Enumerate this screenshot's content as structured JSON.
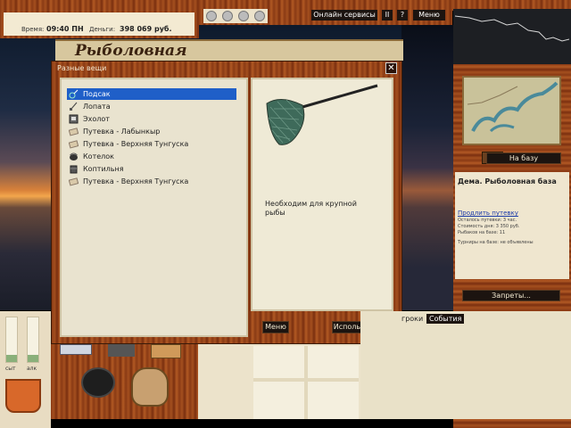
{
  "top": {
    "time_label": "Время:",
    "time_value": "09:40 ПН",
    "money_label": "Деньги:",
    "money_value": "398 069 руб.",
    "online_services": "Онлайн сервисы",
    "pause": "II",
    "help": "?",
    "menu": "Меню"
  },
  "banner": {
    "title": "Рыболовная"
  },
  "dialog": {
    "title": "Разные вещи",
    "close": "✕",
    "items": [
      {
        "label": "Подсак",
        "icon": "landing-net-icon",
        "selected": true
      },
      {
        "label": "Лопата",
        "icon": "shovel-icon",
        "selected": false
      },
      {
        "label": "Эхолот",
        "icon": "echo-sounder-icon",
        "selected": false
      },
      {
        "label": "Путевка - Лабынкыр",
        "icon": "voucher-icon",
        "selected": false
      },
      {
        "label": "Путевка - Верхняя Тунгуска",
        "icon": "voucher-icon",
        "selected": false
      },
      {
        "label": "Котелок",
        "icon": "pot-icon",
        "selected": false
      },
      {
        "label": "Коптильня",
        "icon": "smoker-icon",
        "selected": false
      },
      {
        "label": "Путевка - Верхняя Тунгуска",
        "icon": "voucher-icon",
        "selected": false
      }
    ],
    "description": "Необходим для крупной рыбы",
    "menu_button": "Меню",
    "use_button": "Использовать"
  },
  "right": {
    "to_base": "На базу",
    "base_title": "Дема. Рыболовная база",
    "extend_link": "Продлить путевку",
    "time_left": "Осталось путевки: 3 час.",
    "day_cost": "Стоимость дня: 3 350 руб.",
    "fishers": "Рыбаков на базе: 11",
    "tournaments": "Турниры на базе: не объявлены",
    "bans": "Запреты..."
  },
  "bottom": {
    "players_tab": "гроки",
    "events_tab": "События",
    "gauge1": "сыт",
    "gauge2": "алк"
  },
  "colors": {
    "selection": "#1f5fc8",
    "wood": "#8a3a14",
    "parchment": "#efe6cf"
  }
}
